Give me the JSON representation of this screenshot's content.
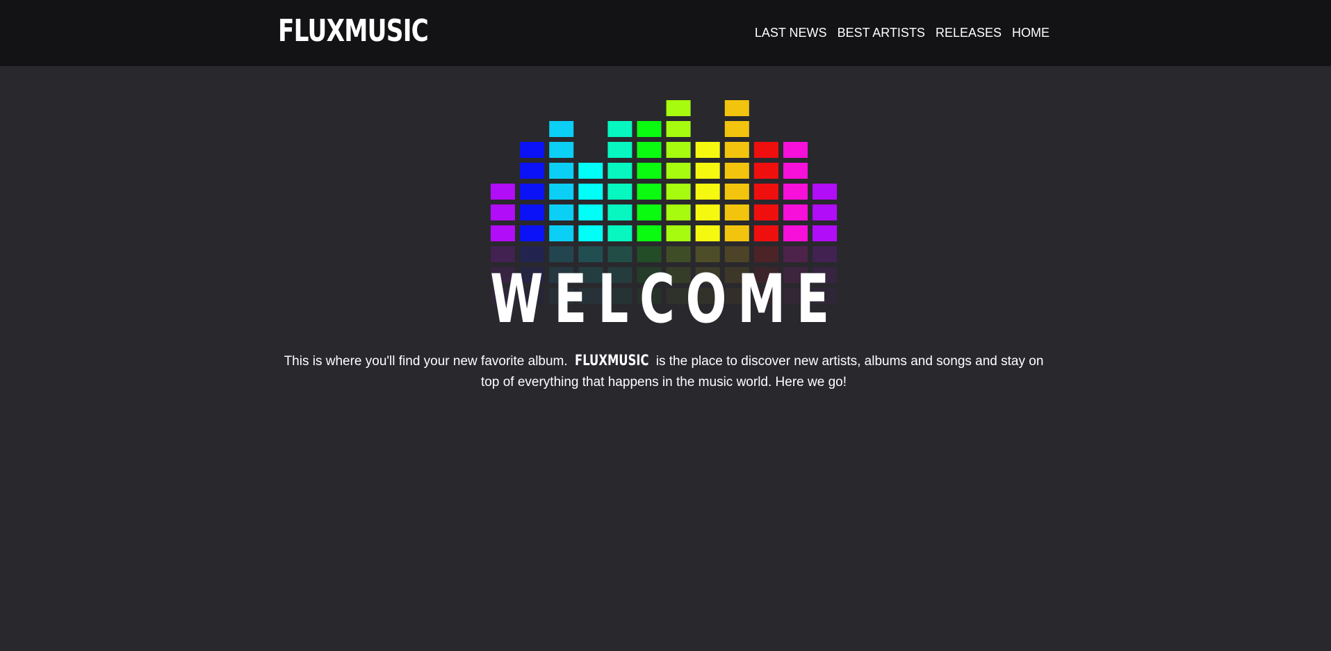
{
  "header": {
    "logo": "FLUXMUSIC",
    "nav": [
      "LAST NEWS",
      "BEST ARTISTS",
      "RELEASES",
      "HOME"
    ]
  },
  "hero": {
    "title": "WELCOME",
    "intro_before": "This is where you'll find your new favorite album. ",
    "intro_brand": "FLUXMUSIC",
    "intro_after": " is the place to discover new artists, albums and songs and stay on top of everything that happens in the music world. Here we go!"
  },
  "equalizer": {
    "columns": [
      {
        "color": "#b10df9",
        "level": 3
      },
      {
        "color": "#0b12f5",
        "level": 5
      },
      {
        "color": "#0ccff5",
        "level": 6
      },
      {
        "color": "#00fff7",
        "level": 4
      },
      {
        "color": "#06f7c0",
        "level": 6
      },
      {
        "color": "#0afa10",
        "level": 6
      },
      {
        "color": "#a6fb0e",
        "level": 7
      },
      {
        "color": "#f5f90f",
        "level": 5
      },
      {
        "color": "#f2c40d",
        "level": 7
      },
      {
        "color": "#f00f0f",
        "level": 5
      },
      {
        "color": "#f610d9",
        "level": 5
      },
      {
        "color": "#b10df9",
        "level": 3
      }
    ]
  },
  "colors": {
    "background": "#29282d",
    "header_background": "#131315",
    "text": "#ffffff"
  }
}
